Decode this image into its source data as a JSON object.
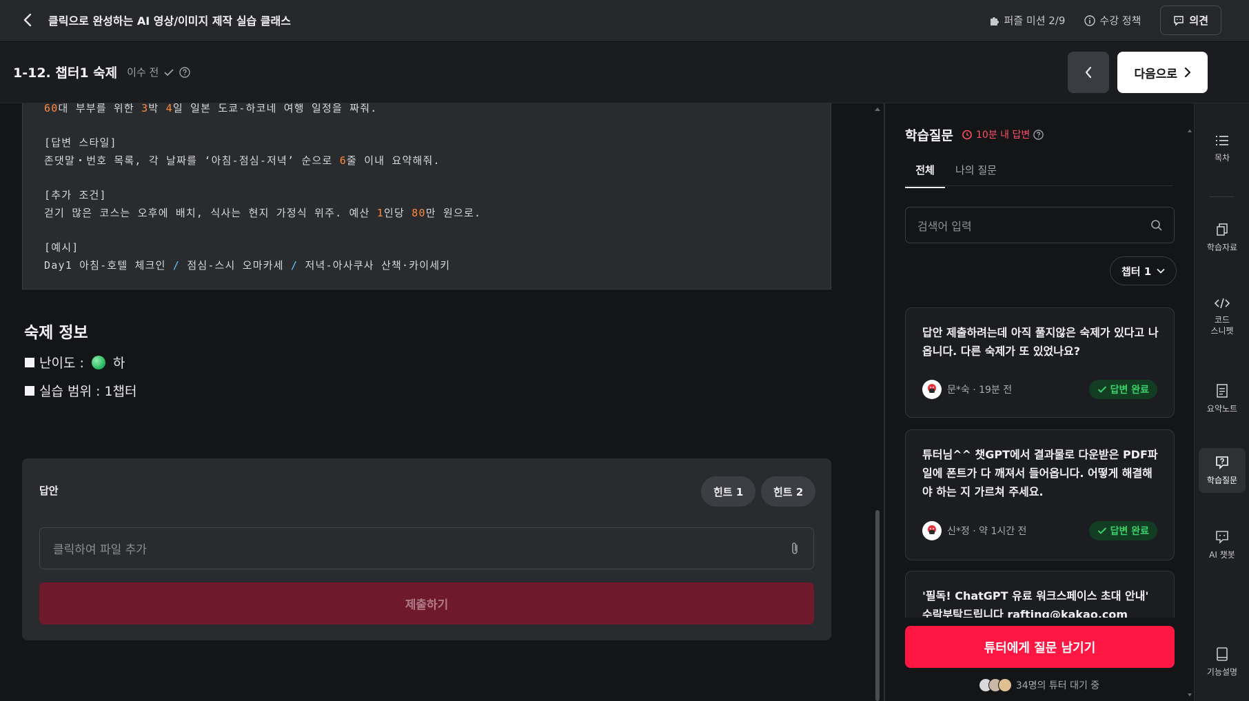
{
  "header": {
    "course_title": "클릭으로 완성하는 AI 영상/이미지 제작 실습 클래스",
    "puzzle_mission": "퍼즐 미션 2/9",
    "policy": "수강 정책",
    "feedback": "의견"
  },
  "lesson": {
    "title": "1-12. 챕터1 숙제",
    "status": "이수 전",
    "next_label": "다음으로"
  },
  "prompt_block": {
    "line1": {
      "a": "",
      "n1": "60",
      "b": "대 부부를 위한 ",
      "n2": "3",
      "c": "박 ",
      "n3": "4",
      "d": "일 일본 도쿄-하코네 여행 일정을 짜줘."
    },
    "style_header": "[답변 스타일]",
    "style_line": {
      "a": "존댓말・번호 목록, 각 날짜를 ‘아침-점심-저녁’ 순으로 ",
      "n1": "6",
      "b": "줄 이내 요약해줘."
    },
    "cond_header": "[추가 조건]",
    "cond_line": {
      "a": "걷기 많은 코스는 오후에 배치, 식사는 현지 가정식 위주. 예산 ",
      "n1": "1",
      "b": "인당 ",
      "n2": "80",
      "c": "만 원으로."
    },
    "example_header": "[예시]",
    "example_line": {
      "a": "Day1 아침-호텔 체크인 ",
      "s1": "/",
      "b": " 점심-스시 오마카세 ",
      "s2": "/",
      "c": " 저녁-아사쿠사 산책·카이세키"
    }
  },
  "homework": {
    "title": "숙제 정보",
    "difficulty_label": "난이도 :",
    "difficulty_value": "하",
    "scope": "실습 범위 : 1챕터"
  },
  "answer": {
    "label": "답안",
    "hint1": "힌트 1",
    "hint2": "힌트 2",
    "file_placeholder": "클릭하여 파일 추가",
    "submit": "제출하기"
  },
  "qa": {
    "title": "학습질문",
    "badge": "10분 내 답변",
    "tabs": [
      "전체",
      "나의 질문"
    ],
    "search_placeholder": "검색어 입력",
    "chapter_filter": "챕터 1",
    "questions": [
      {
        "text": "답안 제출하려는데 아직 풀지않은 숙제가 있다고 나옵니다. 다른 숙제가 또 있었나요?",
        "meta": "문*숙 · 19분 전",
        "status": "답변 완료"
      },
      {
        "text": "튜터님^^ 챗GPT에서 결과물로 다운받은 PDF파일에 폰트가 다 깨져서 들어옵니다. 어떻게 해결해야 하는 지 가르쳐 주세요.",
        "meta": "신*정 · 약 1시간 전",
        "status": "답변 완료"
      },
      {
        "text": "'필독! ChatGPT 유료 워크스페이스 초대 안내' 수락부탁드립니다 rafting@kakao.com",
        "meta": "",
        "status": ""
      }
    ],
    "ask_button": "튜터에게 질문 남기기",
    "tutor_wait": "34명의 튜터 대기 중"
  },
  "rail": {
    "toc": "목차",
    "materials": "학습자료",
    "code_snippet": "코드\n스니펫",
    "summary": "요약노트",
    "questions": "학습질문",
    "chatbot": "AI 챗봇",
    "guide": "기능설명"
  },
  "colors": {
    "accent_red": "#ff1744",
    "number_orange": "#ff8a3d",
    "done_green": "#39d26b"
  }
}
